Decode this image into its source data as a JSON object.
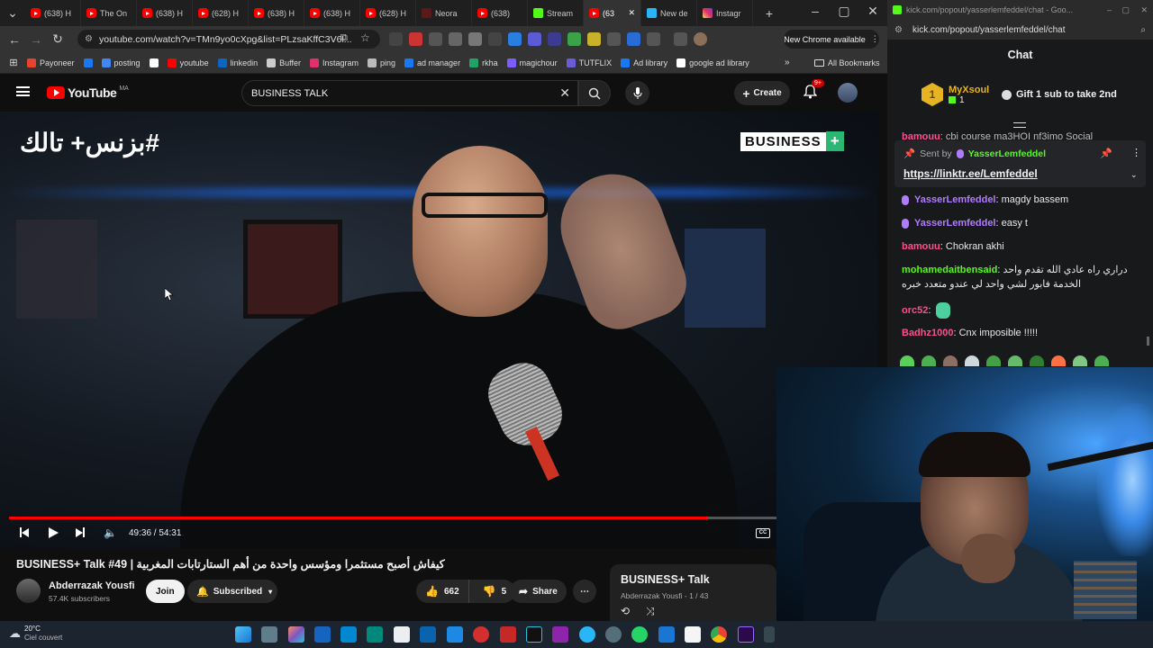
{
  "browser": {
    "tabs": [
      {
        "label": "(638) H",
        "icon": "youtube-icon"
      },
      {
        "label": "The On",
        "icon": "youtube-icon"
      },
      {
        "label": "(638) H",
        "icon": "youtube-icon"
      },
      {
        "label": "(628) H",
        "icon": "youtube-icon"
      },
      {
        "label": "(638) H",
        "icon": "youtube-icon"
      },
      {
        "label": "(638) H",
        "icon": "youtube-icon"
      },
      {
        "label": "(628) H",
        "icon": "youtube-icon"
      },
      {
        "label": "Neora",
        "icon": "neora-icon"
      },
      {
        "label": "(638)",
        "icon": "youtube-icon"
      },
      {
        "label": "Stream",
        "icon": "kick-icon"
      },
      {
        "label": "(63",
        "icon": "youtube-icon"
      },
      {
        "label": "New de",
        "icon": "telegram-icon"
      },
      {
        "label": "Instagr",
        "icon": "instagram-icon"
      }
    ],
    "url": "youtube.com/watch?v=TMn9yo0cXpg&list=PLzsaKffC3V6l...",
    "new_chrome": "New Chrome available",
    "bookmarks": [
      {
        "label": "Payoneer",
        "color": "#e8432e"
      },
      {
        "label": "",
        "color": "#1877f2"
      },
      {
        "label": "posting",
        "color": "#4285f4"
      },
      {
        "label": "",
        "color": "#ffffff"
      },
      {
        "label": "youtube",
        "color": "#ff0000"
      },
      {
        "label": "linkedin",
        "color": "#0a66c2"
      },
      {
        "label": "Buffer",
        "color": "#cccccc"
      },
      {
        "label": "Instagram",
        "color": "#e1306c"
      },
      {
        "label": "ping",
        "color": "#bbbbbb"
      },
      {
        "label": "ad manager",
        "color": "#1877f2"
      },
      {
        "label": "rkha",
        "color": "#21a366"
      },
      {
        "label": "magichour",
        "color": "#7d5cff"
      },
      {
        "label": "TUTFLIX",
        "color": "#6b5bd6"
      },
      {
        "label": "Ad library",
        "color": "#1877f2"
      },
      {
        "label": "google ad library",
        "color": "#ffffff"
      }
    ],
    "all_bookmarks": "All Bookmarks"
  },
  "youtube": {
    "logo": "YouTube",
    "region": "MA",
    "search_value": "BUSINESS TALK",
    "create_label": "Create",
    "notif_count": "9+",
    "video_overlay_ar": "#بزنس+ تالك",
    "video_overlay_brand": "BUSINESS",
    "video_overlay_plus": "+",
    "time": "49:36 / 54:31",
    "progress": 0.91,
    "title": "BUSINESS+ Talk #49 | كيفاش أصبح مستثمرا ومؤسس واحدة من أهم الستارتابات المغربية",
    "channel": "Abderrazak Yousfi",
    "subs": "57.4K subscribers",
    "join": "Join",
    "subscribed": "Subscribed",
    "likes": "662",
    "dislikes": "5",
    "share": "Share",
    "playlist_title": "BUSINESS+ Talk",
    "playlist_meta": "Abderrazak Yousfi - 1 / 43"
  },
  "kick": {
    "window_title": "kick.com/popout/yasserlemfeddel/chat - Goo...",
    "url": "kick.com/popout/yasserlemfeddel/chat",
    "chat_title": "Chat",
    "gifter_name": "MyXsoul",
    "gifter_count": "1",
    "gift_text": "Gift 1 sub to take 2nd",
    "pinned_sent_by": "Sent by",
    "pinned_user": "YasserLemfeddel",
    "pinned_link": "https://linktr.ee/Lemfeddel",
    "partial_msg_user": "bamouu",
    "partial_msg_text": ": cbi course ma3HOI nf3imo Social",
    "messages": [
      {
        "user": "YasserLemfeddel",
        "text": ": magdy bassem",
        "color": "#b07cff",
        "badge": true
      },
      {
        "user": "YasserLemfeddel",
        "text": ": easy t",
        "color": "#b07cff",
        "badge": true
      },
      {
        "user": "bamouu",
        "text": ": Chokran akhi",
        "color": "#ff4d8d",
        "badge": false
      },
      {
        "user": "mohamedaitbensaid",
        "text": ": دراري راه عادي الله تقدم واحد",
        "color": "#53fc18",
        "badge": false
      },
      {
        "user": "",
        "text": "الخدمة فابور لشي واحد لي عندو متعدد خبره",
        "color": "#53fc18",
        "badge": false
      },
      {
        "user": "orc52",
        "text": ":",
        "color": "#ff4d8d",
        "badge": false
      },
      {
        "user": "Badhz1000",
        "text": ": Cnx imposible !!!!!",
        "color": "#ff4d8d",
        "badge": false
      }
    ]
  },
  "taskbar": {
    "temp": "20°C",
    "weather": "Ciel couvert"
  }
}
